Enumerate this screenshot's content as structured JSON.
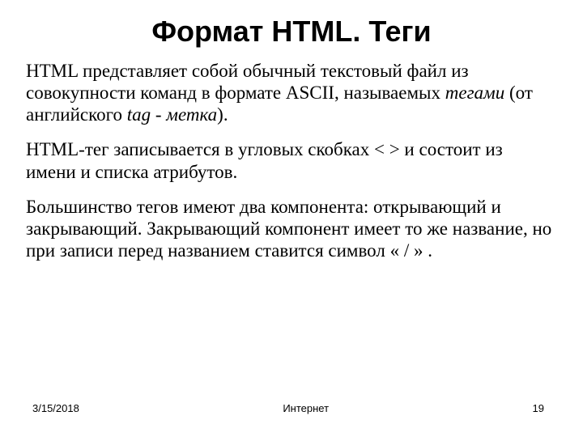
{
  "title": "Формат HTML. Теги",
  "p1": {
    "s1": "HTML представляет собой обычный текстовый файл из совокупности команд в формате ASCII, называемых ",
    "s2": "тегами",
    "s3": " (от английского ",
    "s4": "tag",
    "s5": " - ",
    "s6": "метка",
    "s7": ")."
  },
  "p2": "HTML-тег записывается в угловых скобках < > и состоит из имени и списка атрибутов.",
  "p3": "Большинство тегов имеют два компонента: открывающий и закрывающий. Закрывающий компонент имеет то же название, но при записи перед названием ставится символ « / » .",
  "footer": {
    "date": "3/15/2018",
    "center": "Интернет",
    "page": "19"
  }
}
